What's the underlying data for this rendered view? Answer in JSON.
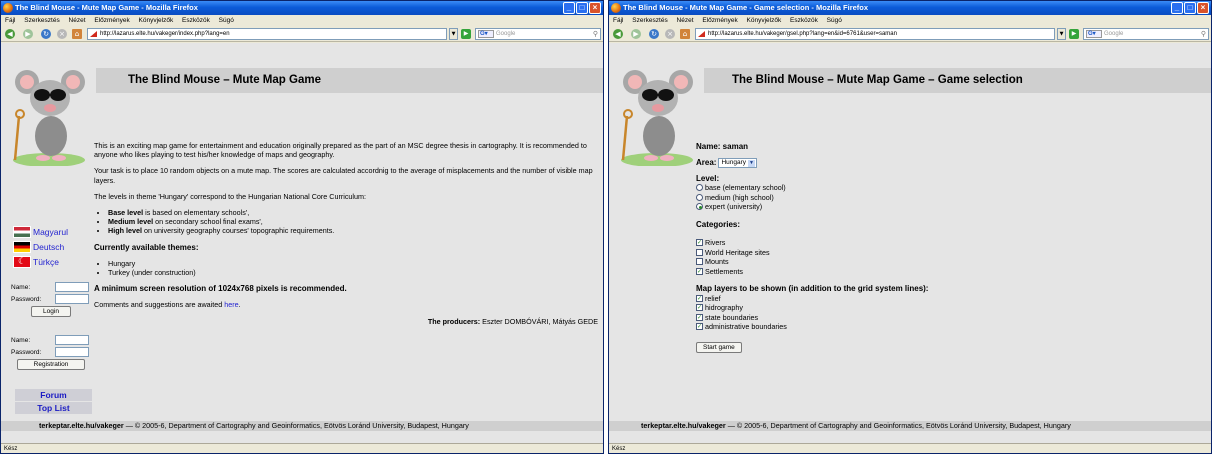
{
  "left_window": {
    "title": "The Blind Mouse - Mute Map Game - Mozilla Firefox",
    "menu": [
      "Fájl",
      "Szerkesztés",
      "Nézet",
      "Előzmények",
      "Könyvjelzők",
      "Eszközök",
      "Súgó"
    ],
    "url": "http://lazarus.elte.hu/vakeger/index.php?lang=en",
    "search_placeholder": "Google",
    "page_heading": "The Blind Mouse – Mute Map Game",
    "languages": [
      "Magyarul",
      "Deutsch",
      "Türkçe"
    ],
    "login": {
      "name_label": "Name:",
      "password_label": "Password:",
      "button": "Login"
    },
    "register": {
      "name_label": "Name:",
      "password_label": "Password:",
      "button": "Registration"
    },
    "side_links": [
      "Forum",
      "Top List"
    ],
    "intro_1": "This is an exciting map game for entertainment and education originally prepared as the part of an MSC degree thesis in cartography. It is recommended to anyone who likes playing to test his/her knowledge of maps and geography.",
    "intro_2": "Your task is to place 10 random objects on a mute map. The scores are calculated accordnig to the average of misplacements and the number of visible map layers.",
    "intro_3": "The levels in theme 'Hungary' correspond to the Hungarian National Core Curriculum:",
    "levels": [
      {
        "bold": "Base level",
        "rest": " is based on elementary schools',"
      },
      {
        "bold": "Medium level",
        "rest": " on secondary school final exams',"
      },
      {
        "bold": "High level",
        "rest": " on university geography courses' topographic requirements."
      }
    ],
    "themes_heading": "Currently available themes:",
    "themes": [
      "Hungary",
      "Turkey (under construction)"
    ],
    "resolution_note": "A minimum screen resolution of 1024x768 pixels is recommended.",
    "comments_text": "Comments and suggestions are awaited ",
    "comments_link": "here",
    "producers_label": "The producers:",
    "producers_names": " Eszter DOMBÓVÁRI, Mátyás GEDE",
    "footer_bold": "terkeptar.elte.hu/vakeger",
    "footer_rest": " — © 2005-6, Department of Cartography and Geoinformatics, Eötvös Loránd University, Budapest, Hungary",
    "status": "Kész"
  },
  "right_window": {
    "title": "The Blind Mouse - Mute Map Game - Game selection - Mozilla Firefox",
    "menu": [
      "Fájl",
      "Szerkesztés",
      "Nézet",
      "Előzmények",
      "Könyvjelzők",
      "Eszközök",
      "Súgó"
    ],
    "url": "http://lazarus.elte.hu/vakeger/gsel.php?lang=en&id=6761&user=saman",
    "search_placeholder": "Google",
    "page_heading": "The Blind Mouse – Mute Map Game – Game selection",
    "name_line": "Name: saman",
    "area_label": "Area:",
    "area_value": "Hungary",
    "level_label": "Level:",
    "levels": [
      {
        "label": "base (elementary school)",
        "checked": false
      },
      {
        "label": "medium (high school)",
        "checked": false
      },
      {
        "label": "expert (university)",
        "checked": true
      }
    ],
    "categories_label": "Categories:",
    "categories": [
      {
        "label": "Rivers",
        "checked": true
      },
      {
        "label": "World Heritage sites",
        "checked": false
      },
      {
        "label": "Mounts",
        "checked": false
      },
      {
        "label": "Settlements",
        "checked": true
      }
    ],
    "layers_label": "Map layers to be shown (in addition to the grid system lines):",
    "layers": [
      {
        "label": "relief",
        "checked": true
      },
      {
        "label": "hidrography",
        "checked": true
      },
      {
        "label": "state boundaries",
        "checked": true
      },
      {
        "label": "administrative boundaries",
        "checked": true
      }
    ],
    "start_button": "Start game",
    "footer_bold": "terkeptar.elte.hu/vakeger",
    "footer_rest": " — © 2005-6, Department of Cartography and Geoinformatics, Eötvös Loránd University, Budapest, Hungary",
    "status": "Kész"
  }
}
